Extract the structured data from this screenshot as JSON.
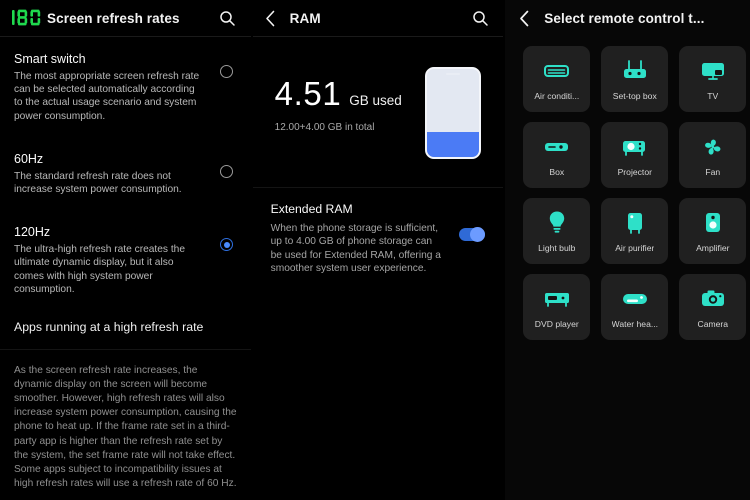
{
  "colors": {
    "accent_green": "#22dd55",
    "accent_blue": "#4a8cff",
    "accent_teal": "#2ee0c8",
    "tile_bg": "#202020",
    "panel_bg": "#000000"
  },
  "refresh_panel": {
    "logo": "120-segment-logo",
    "title": "Screen refresh rates",
    "search_icon": "search-icon",
    "options": [
      {
        "title": "Smart switch",
        "desc": "The most appropriate screen refresh rate can be selected automatically according to the actual usage scenario and system power consumption.",
        "selected": false
      },
      {
        "title": "60Hz",
        "desc": "The standard refresh rate does not increase system power consumption.",
        "selected": false
      },
      {
        "title": "120Hz",
        "desc": "The ultra-high refresh rate creates the ultimate dynamic display, but it also comes with high system power consumption.",
        "selected": true
      }
    ],
    "section_header": "Apps running at a high refresh rate",
    "footer_note": "As the screen refresh rate increases, the dynamic display on the screen will become smoother. However, high refresh rates will also increase system power consumption, causing the phone to heat up. If the frame rate set in a third-party app is higher than the refresh rate set by the system, the set frame rate will not take effect. Some apps subject to incompatibility issues at high refresh rates will use a refresh rate of 60 Hz."
  },
  "ram_panel": {
    "back_icon": "back-chevron-icon",
    "title": "RAM",
    "search_icon": "search-icon",
    "used_value": "4.51",
    "used_unit": "GB used",
    "total_line": "12.00+4.00 GB in total",
    "usage_percent": 28,
    "extended": {
      "title": "Extended RAM",
      "desc": "When the phone storage is sufficient, up to 4.00 GB of phone storage can be used for Extended RAM, offering a smoother system user experience.",
      "toggle_on": true
    }
  },
  "remote_panel": {
    "back_icon": "back-chevron-icon",
    "title": "Select remote control t...",
    "devices": [
      {
        "label": "Air conditi...",
        "icon": "air-conditioner-icon"
      },
      {
        "label": "Set-top box",
        "icon": "set-top-box-icon"
      },
      {
        "label": "TV",
        "icon": "tv-icon"
      },
      {
        "label": "Box",
        "icon": "box-icon"
      },
      {
        "label": "Projector",
        "icon": "projector-icon"
      },
      {
        "label": "Fan",
        "icon": "fan-icon"
      },
      {
        "label": "Light bulb",
        "icon": "light-bulb-icon"
      },
      {
        "label": "Air purifier",
        "icon": "air-purifier-icon"
      },
      {
        "label": "Amplifier",
        "icon": "amplifier-icon"
      },
      {
        "label": "DVD player",
        "icon": "dvd-player-icon"
      },
      {
        "label": "Water hea...",
        "icon": "water-heater-icon"
      },
      {
        "label": "Camera",
        "icon": "camera-icon"
      }
    ]
  }
}
